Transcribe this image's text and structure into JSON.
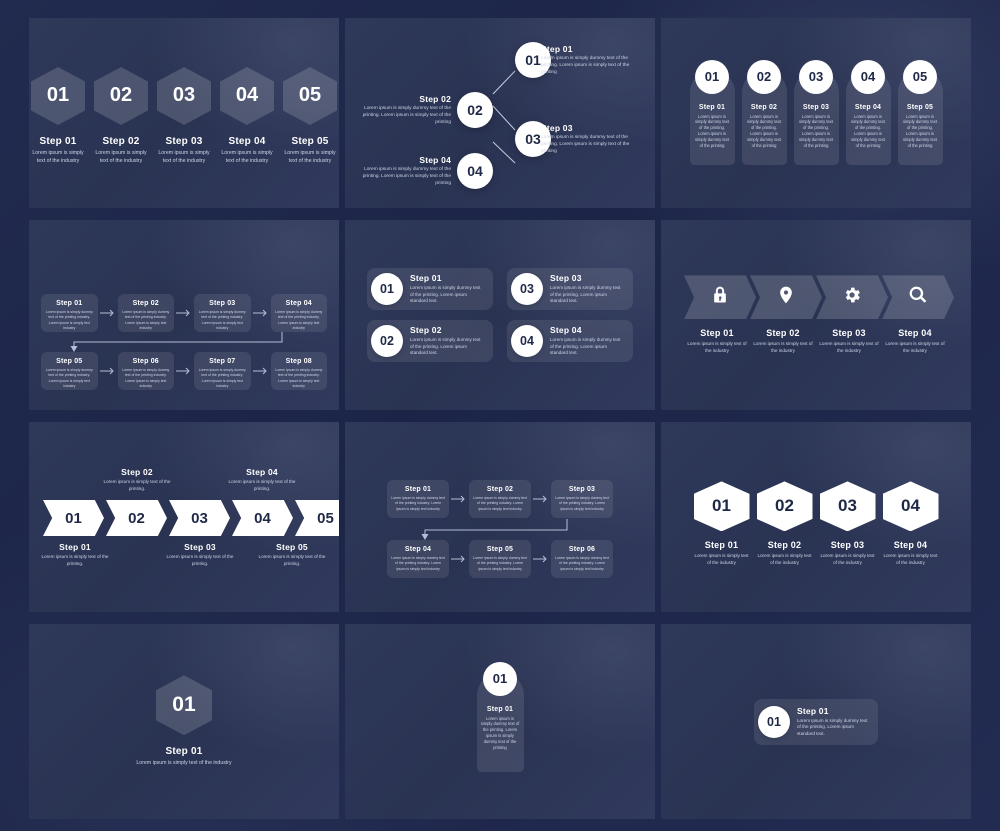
{
  "colors": {
    "page_background": "#1b2545",
    "panel_background": "#2d3656",
    "accent_white": "#ffffff",
    "number_text": "#1f2947",
    "title_text": "#ffffff",
    "description_text": "#cfd4e6",
    "translucent_shape": "rgba(255,255,255,0.16)"
  },
  "text": {
    "industry": "Lorem ipsum is simply text of the industry",
    "printing_long": "Lorem ipsum is simply dummy text of the printing. Lorem ipsum is simply text of the printing",
    "printing_dummy": "Lorem ipsum is simply dummy text of the printing. Lorem ipsum is simply dummy text of the printing",
    "printing_industry": "Lorem ipsum is simply dummy text of the printing industry. Lorem ipsum is simply text industry",
    "standard_text": "Lorem ipsum is simply dummy text of the printing. Lorem ipsum standard text.",
    "printing_short": "Lorem ipsum is simply text of the printing."
  },
  "panels": [
    {
      "id": "hexagon-steps",
      "layout": "soft-hexagon-row",
      "steps": [
        {
          "number": "01",
          "title": "Step 01",
          "desc": "Lorem ipsum is simply text of the industry"
        },
        {
          "number": "02",
          "title": "Step 02",
          "desc": "Lorem ipsum is simply text of the industry"
        },
        {
          "number": "03",
          "title": "Step 03",
          "desc": "Lorem ipsum is simply text of the industry"
        },
        {
          "number": "04",
          "title": "Step 04",
          "desc": "Lorem ipsum is simply text of the industry"
        },
        {
          "number": "05",
          "title": "Step 05",
          "desc": "Lorem ipsum is simply text of the industry"
        }
      ]
    },
    {
      "id": "zigzag-circles",
      "layout": "connected-circle-tree",
      "steps": [
        {
          "number": "01",
          "title": "Step 01",
          "desc": "Lorem ipsum is simply dummy text of the printing. Lorem ipsum is simply text of the printing",
          "side": "right"
        },
        {
          "number": "02",
          "title": "Step 02",
          "desc": "Lorem ipsum is simply dummy text of the printing. Lorem ipsum is simply text of the printing",
          "side": "left"
        },
        {
          "number": "03",
          "title": "Step 03",
          "desc": "Lorem ipsum is simply dummy text of the printing. Lorem ipsum is simply text of the printing",
          "side": "right"
        },
        {
          "number": "04",
          "title": "Step 04",
          "desc": "Lorem ipsum is simply dummy text of the printing. Lorem ipsum is simply text of the printing",
          "side": "left"
        }
      ]
    },
    {
      "id": "arch-cards",
      "layout": "arched-card-row",
      "steps": [
        {
          "number": "01",
          "title": "Step 01",
          "desc": "Lorem ipsum is simply dummy text of the printing. Lorem ipsum is simply dummy text of the printing"
        },
        {
          "number": "02",
          "title": "Step 02",
          "desc": "Lorem ipsum is simply dummy text of the printing. Lorem ipsum is simply dummy text of the printing"
        },
        {
          "number": "03",
          "title": "Step 03",
          "desc": "Lorem ipsum is simply dummy text of the printing. Lorem ipsum is simply dummy text of the printing"
        },
        {
          "number": "04",
          "title": "Step 04",
          "desc": "Lorem ipsum is simply dummy text of the printing. Lorem ipsum is simply dummy text of the printing"
        },
        {
          "number": "05",
          "title": "Step 05",
          "desc": "Lorem ipsum is simply dummy text of the printing. Lorem ipsum is simply dummy text of the printing"
        }
      ]
    },
    {
      "id": "flow-eight",
      "layout": "snake-flow-8",
      "steps": [
        {
          "title": "Step 01",
          "desc": "Lorem ipsum is simply dummy text of the printing industry. Lorem ipsum is simply text industry"
        },
        {
          "title": "Step 02",
          "desc": "Lorem ipsum is simply dummy text of the printing industry. Lorem ipsum is simply text industry"
        },
        {
          "title": "Step 03",
          "desc": "Lorem ipsum is simply dummy text of the printing industry. Lorem ipsum is simply text industry"
        },
        {
          "title": "Step 04",
          "desc": "Lorem ipsum is simply dummy text of the printing industry. Lorem ipsum is simply text industry"
        },
        {
          "title": "Step 05",
          "desc": "Lorem ipsum is simply dummy text of the printing industry. Lorem ipsum is simply text industry"
        },
        {
          "title": "Step 06",
          "desc": "Lorem ipsum is simply dummy text of the printing industry. Lorem ipsum is simply text industry"
        },
        {
          "title": "Step 07",
          "desc": "Lorem ipsum is simply dummy text of the printing industry. Lorem ipsum is simply text industry"
        },
        {
          "title": "Step 08",
          "desc": "Lorem ipsum is simply dummy text of the printing industry. Lorem ipsum is simply text industry"
        }
      ]
    },
    {
      "id": "pill-grid",
      "layout": "two-by-two-pill-cards",
      "steps": [
        {
          "number": "01",
          "title": "Step 01",
          "desc": "Lorem ipsum is simply dummy text of the printing. Lorem ipsum standard text."
        },
        {
          "number": "02",
          "title": "Step 02",
          "desc": "Lorem ipsum is simply dummy text of the printing. Lorem ipsum standard text."
        },
        {
          "number": "03",
          "title": "Step 03",
          "desc": "Lorem ipsum is simply dummy text of the printing. Lorem ipsum standard text."
        },
        {
          "number": "04",
          "title": "Step 04",
          "desc": "Lorem ipsum is simply dummy text of the printing. Lorem ipsum standard text."
        }
      ]
    },
    {
      "id": "chevron-icons",
      "layout": "chevron-icon-row",
      "steps": [
        {
          "icon": "lock-icon",
          "title": "Step 01",
          "desc": "Lorem ipsum is simply text of the industry"
        },
        {
          "icon": "location-pin-icon",
          "title": "Step 02",
          "desc": "Lorem ipsum is simply text of the industry"
        },
        {
          "icon": "gear-icon",
          "title": "Step 03",
          "desc": "Lorem ipsum is simply text of the industry"
        },
        {
          "icon": "search-icon",
          "title": "Step 04",
          "desc": "Lorem ipsum is simply text of the industry"
        }
      ]
    },
    {
      "id": "white-ribbon",
      "layout": "white-chevron-ribbon",
      "steps": [
        {
          "number": "01",
          "title": "Step 01",
          "desc": "Lorem ipsum is simply text of the printing.",
          "position": "below"
        },
        {
          "number": "02",
          "title": "Step 02",
          "desc": "Lorem ipsum is simply text of the printing.",
          "position": "above"
        },
        {
          "number": "03",
          "title": "Step 03",
          "desc": "Lorem ipsum is simply text of the printing.",
          "position": "below"
        },
        {
          "number": "04",
          "title": "Step 04",
          "desc": "Lorem ipsum is simply text of the printing.",
          "position": "above"
        },
        {
          "number": "05",
          "title": "Step 05",
          "desc": "Lorem ipsum is simply text of the printing.",
          "position": "below"
        }
      ]
    },
    {
      "id": "flow-six",
      "layout": "snake-flow-6",
      "steps": [
        {
          "title": "Step 01",
          "desc": "Lorem ipsum is simply dummy text of the printing industry. Lorem ipsum is simply text industry"
        },
        {
          "title": "Step 02",
          "desc": "Lorem ipsum is simply dummy text of the printing industry. Lorem ipsum is simply text industry"
        },
        {
          "title": "Step 03",
          "desc": "Lorem ipsum is simply dummy text of the printing industry. Lorem ipsum is simply text industry"
        },
        {
          "title": "Step 04",
          "desc": "Lorem ipsum is simply dummy text of the printing industry. Lorem ipsum is simply text industry"
        },
        {
          "title": "Step 05",
          "desc": "Lorem ipsum is simply dummy text of the printing industry. Lorem ipsum is simply text industry"
        },
        {
          "title": "Step 06",
          "desc": "Lorem ipsum is simply dummy text of the printing industry. Lorem ipsum is simply text industry"
        }
      ]
    },
    {
      "id": "white-hexagons",
      "layout": "white-hexagon-row",
      "steps": [
        {
          "number": "01",
          "title": "Step 01",
          "desc": "Lorem ipsum is simply text of the industry"
        },
        {
          "number": "02",
          "title": "Step 02",
          "desc": "Lorem ipsum is simply text of the industry"
        },
        {
          "number": "03",
          "title": "Step 03",
          "desc": "Lorem ipsum is simply text of the industry"
        },
        {
          "number": "04",
          "title": "Step 04",
          "desc": "Lorem ipsum is simply text of the industry"
        }
      ]
    },
    {
      "id": "single-hexagon",
      "layout": "single-soft-hexagon",
      "steps": [
        {
          "number": "01",
          "title": "Step 01",
          "desc": "Lorem ipsum is simply text of the industry"
        }
      ]
    },
    {
      "id": "single-arch-card",
      "layout": "single-arched-card",
      "steps": [
        {
          "number": "01",
          "title": "Step 01",
          "desc": "Lorem ipsum is simply dummy text of the printing. Lorem ipsum is simply dummy text of the printing"
        }
      ]
    },
    {
      "id": "single-pill",
      "layout": "single-pill-card",
      "steps": [
        {
          "number": "01",
          "title": "Step 01",
          "desc": "Lorem ipsum is simply dummy text of the printing. Lorem ipsum standard text."
        }
      ]
    }
  ]
}
